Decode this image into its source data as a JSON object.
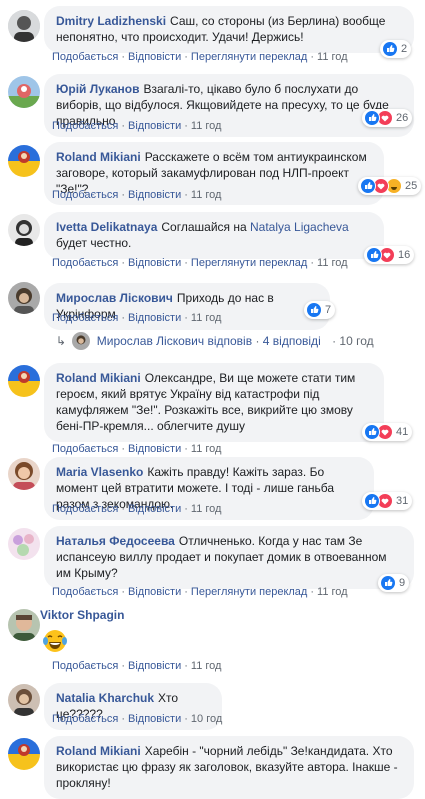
{
  "actions": {
    "like": "Подобається",
    "reply": "Відповісти",
    "translate": "Переглянути переклад",
    "sep": "·"
  },
  "comments": [
    {
      "author": "Dmitry Ladizhenski",
      "text": "Саш, со стороны (из Берлина) вообще непонятно, что происходит. Удачи! Держись!",
      "time": "11 год",
      "reactions": "2",
      "translate": true
    },
    {
      "author": "Юрій Луканов",
      "text": "Взагалі-то, цікаво було б послухати до виборів, що відбулося. Якщовийдете на пресуху, то це буде правильно",
      "time": "11 год",
      "reactions": "26",
      "translate": false
    },
    {
      "author": "Roland Mikiani",
      "text": "Расскажете о всём том антиукраинском заговоре, который закамуфлирован под НЛП-проект \"Зе!\"?",
      "time": "11 год",
      "reactions": "25",
      "translate": false
    },
    {
      "author": "Ivetta Delikatnaya",
      "text_before": "Соглашайся на ",
      "mention": "Natalya Ligacheva",
      "text_after": " будет честно.",
      "time": "11 год",
      "reactions": "16",
      "translate": true
    },
    {
      "author": "Мирослав Ліскович",
      "text": "Приходь до нас в Укрінформ",
      "time": "11 год",
      "reactions": "7",
      "translate": false,
      "replies": {
        "name": "Мирослав Ліскович",
        "verb": "відповів",
        "count": "4 відповіді",
        "time": "10 год"
      }
    },
    {
      "author": "Roland Mikiani",
      "text": "Олександре, Ви ще можете стати тим героєм, який врятує Україну від катастрофи під камуфляжем \"Зе!\". Розкажіть все, викрийте цю змову бені-ПР-кремля... облегчите душу",
      "time": "11 год",
      "reactions": "41",
      "translate": false
    },
    {
      "author": "Maria Vlasenko",
      "text": "Кажіть правду! Кажіть зараз. Бо момент цей втратити можете. І тоді - лише ганьба разом з зекомандою.",
      "time": "11 год",
      "reactions": "31",
      "translate": false
    },
    {
      "author": "Наталья Федосеева",
      "text": "Отличненько. Когда у нас там Зе испансеую виллу продает и покупает домик в отвоеванном им Крыму?",
      "time": "11 год",
      "reactions": "9",
      "translate": true
    },
    {
      "author": "Viktor Shpagin",
      "emoji": "face-with-tears-of-joy",
      "time": "11 год",
      "translate": false
    },
    {
      "author": "Natalia Kharchuk",
      "text": "Хто це?????",
      "time": "10 год",
      "translate": false
    },
    {
      "author": "Roland Mikiani",
      "text": "Харебін - \"чорний лебідь\" Зе!кандидата. Хто використає цю фразу як заголовок, вказуйте автора. Інакше - прокляну!",
      "time": "",
      "translate": false
    }
  ],
  "colors": {
    "link": "#385898",
    "bubble": "#f2f3f5",
    "meta": "#606770",
    "like": "#1877f2",
    "love": "#f33e58",
    "haha": "#f7b125"
  }
}
